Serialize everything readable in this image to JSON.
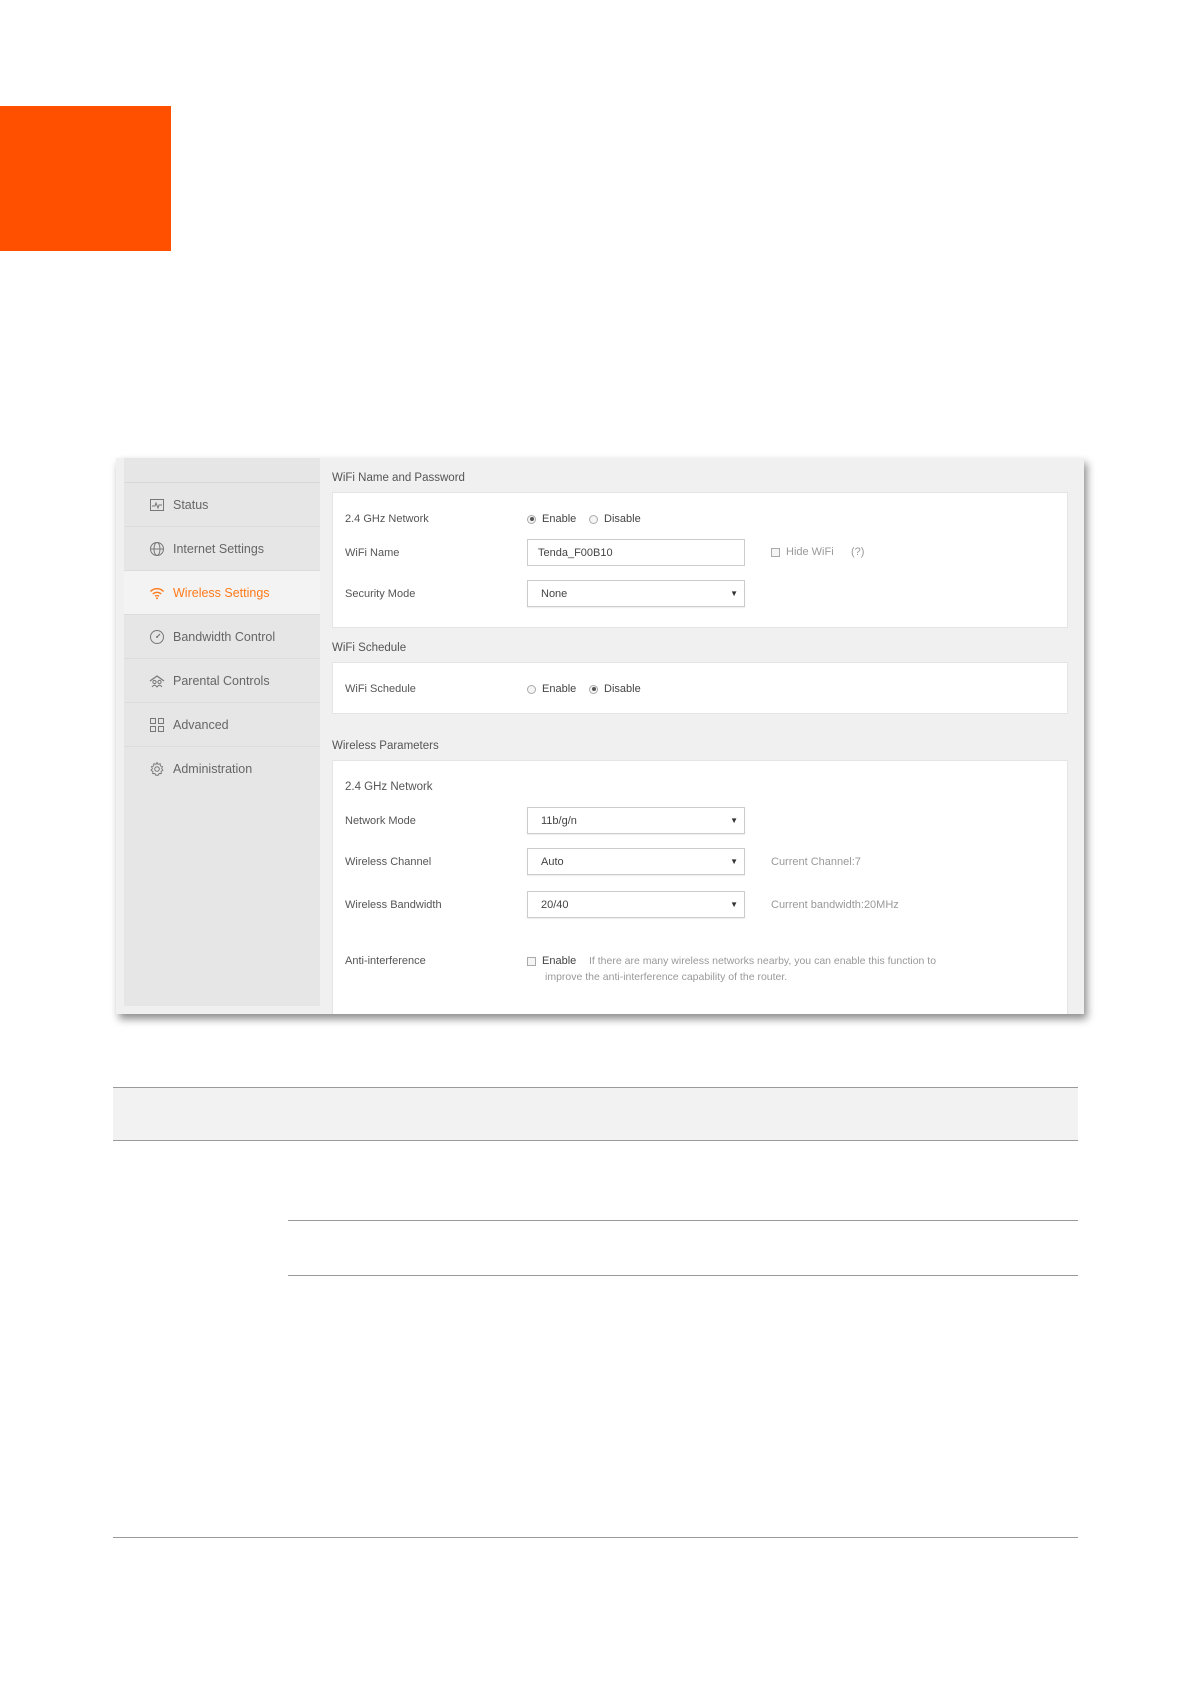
{
  "sidebar": {
    "items": [
      {
        "label": "Status",
        "icon": "status-icon",
        "active": false
      },
      {
        "label": "Internet Settings",
        "icon": "globe-icon",
        "active": false
      },
      {
        "label": "Wireless Settings",
        "icon": "wifi-icon",
        "active": true
      },
      {
        "label": "Bandwidth Control",
        "icon": "gauge-icon",
        "active": false
      },
      {
        "label": "Parental Controls",
        "icon": "parental-icon",
        "active": false
      },
      {
        "label": "Advanced",
        "icon": "grid-icon",
        "active": false
      },
      {
        "label": "Administration",
        "icon": "gear-icon",
        "active": false
      }
    ]
  },
  "wifi_name_password": {
    "title": "WiFi Name and Password",
    "network_label": "2.4 GHz Network",
    "enable_label": "Enable",
    "disable_label": "Disable",
    "wifi_name_label": "WiFi Name",
    "wifi_name_value": "Tenda_F00B10",
    "hide_wifi_label": "Hide WiFi",
    "help_label": "(?)",
    "security_mode_label": "Security Mode",
    "security_mode_value": "None"
  },
  "wifi_schedule": {
    "title": "WiFi Schedule",
    "label": "WiFi Schedule",
    "enable_label": "Enable",
    "disable_label": "Disable"
  },
  "wireless_parameters": {
    "title": "Wireless Parameters",
    "network_label": "2.4 GHz Network",
    "network_mode_label": "Network Mode",
    "network_mode_value": "11b/g/n",
    "channel_label": "Wireless Channel",
    "channel_value": "Auto",
    "current_channel": "Current Channel:7",
    "bandwidth_label": "Wireless Bandwidth",
    "bandwidth_value": "20/40",
    "current_bandwidth": "Current bandwidth:20MHz",
    "anti_label": "Anti-interference",
    "anti_enable_label": "Enable",
    "anti_hint_line1": "If there are many wireless networks nearby, you can enable this function to",
    "anti_hint_line2": "improve the anti-interference capability of the router."
  },
  "colors": {
    "brand_orange": "#ff5000",
    "active_nav": "#ff7a1a"
  }
}
